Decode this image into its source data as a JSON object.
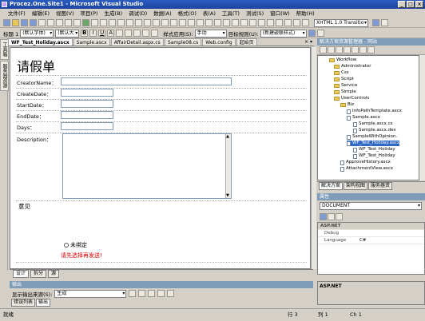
{
  "title": "Procez.One.Site1 - Microsoft Visual Studio",
  "menu": [
    "文件(F)",
    "编辑(E)",
    "视图(V)",
    "项目(P)",
    "生成(B)",
    "调试(D)",
    "数据(A)",
    "格式(O)",
    "表(A)",
    "工具(T)",
    "测试(S)",
    "窗口(W)",
    "帮助(H)"
  ],
  "toolbar2": {
    "doctype": "XHTML 1.0 Transitio"
  },
  "toolbar3": {
    "block": "标题 1",
    "font": "(默认字体)",
    "size": "(默认大",
    "style_label": "样式应用(S):",
    "style_mode": "手动",
    "target_label": "目标规则(U):",
    "target": "(新建嵌联样式)"
  },
  "doctabs": [
    "WF_Test_Holiday.ascx",
    "Sample.ascx",
    "AffairDetail.aspx.cs",
    "Sample08.cs",
    "Web.config",
    "起始页"
  ],
  "lefttabs": [
    "工具箱",
    "服务器资源"
  ],
  "form": {
    "title": "请假单",
    "fields": [
      "CreatorName：",
      "CreateDate：",
      "StartDate：",
      "EndDate：",
      "Days：",
      "Description："
    ],
    "opinion": "意见",
    "radio": "未绑定",
    "warning": "请先选择再发送!"
  },
  "viewtabs": [
    "设计",
    "拆分",
    "源"
  ],
  "solution": {
    "title": "解决方案资源管理器 - 网站",
    "tree": [
      "Workflow",
      "Administrator",
      "Css",
      "Script",
      "Service",
      "Simple",
      "UserControls",
      "Biz",
      "InfoPathTemplate.ascx",
      "Sample.ascx",
      "Sample.ascx.cs",
      "Sample.ascx.des",
      "SampleWithOpinion.",
      "WF_Test_Holiday.ascx",
      "WF_Test_Holiday",
      "WF_Test_Holiday",
      "ApproveHistory.ascx",
      "AttachmentView.ascx"
    ],
    "tabs": [
      "解决方案",
      "架构视图",
      "服务器资"
    ]
  },
  "properties": {
    "title": "属性",
    "object": "DOCUMENT",
    "category": "ASP.NET",
    "rows": [
      {
        "k": "Debug",
        "v": ""
      },
      {
        "k": "Language",
        "v": "C#"
      }
    ],
    "desc": "ASP.NET"
  },
  "output": {
    "title": "输出",
    "source_label": "显示输出来源(S):",
    "source": "生成",
    "tabs": [
      "错误列表",
      "输出"
    ]
  },
  "status": {
    "ready": "就绪",
    "row": "行 3",
    "col": "列 1",
    "ch": "Ch 1"
  }
}
